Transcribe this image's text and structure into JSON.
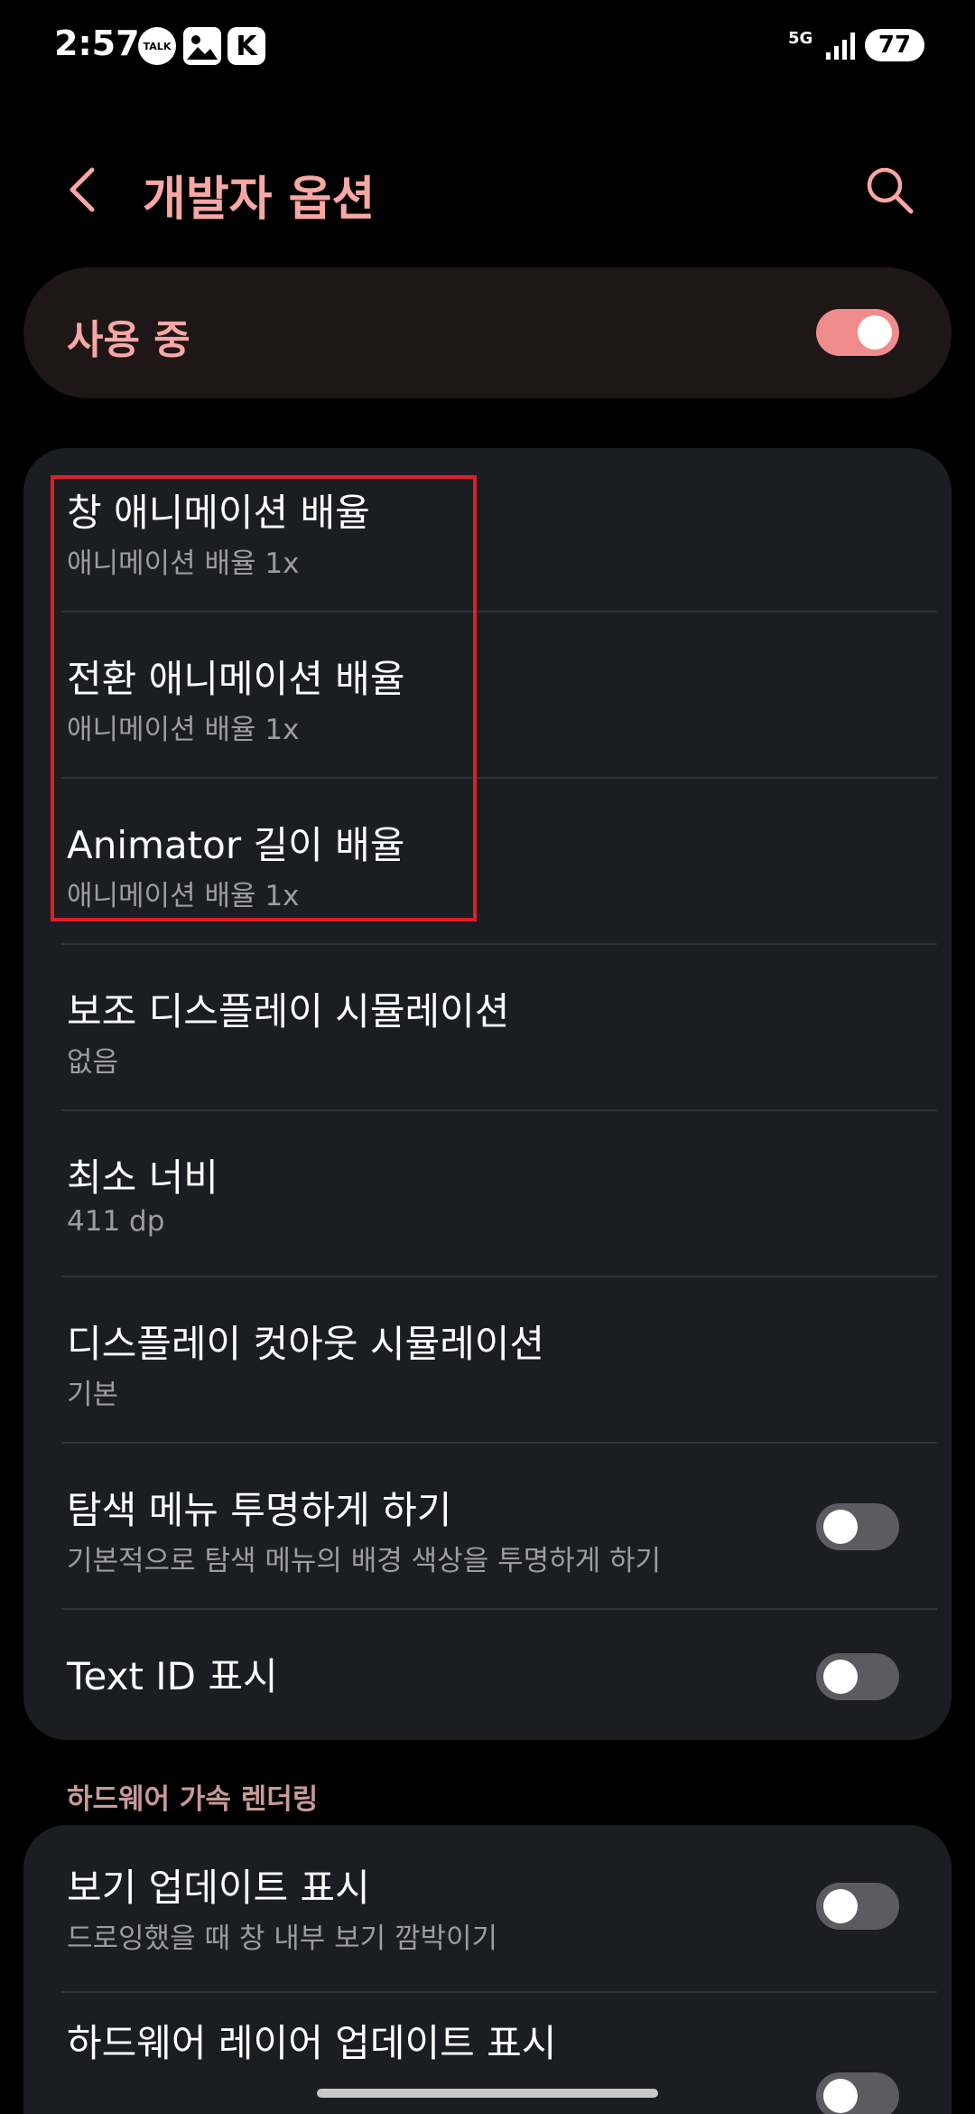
{
  "status_bar": {
    "time": "2:57",
    "talk_badge": "TALK",
    "k_badge": "K",
    "network": "5G",
    "battery": "77"
  },
  "header": {
    "title": "개발자 옵션",
    "accent_color": "#f7a7a4"
  },
  "master_switch": {
    "label": "사용 중",
    "on": true
  },
  "settings": [
    {
      "title": "창 애니메이션 배율",
      "subtitle": "애니메이션 배율 1x"
    },
    {
      "title": "전환 애니메이션 배율",
      "subtitle": "애니메이션 배율 1x"
    },
    {
      "title": "Animator 길이 배율",
      "subtitle": "애니메이션 배율 1x"
    },
    {
      "title": "보조 디스플레이 시뮬레이션",
      "subtitle": "없음"
    },
    {
      "title": "최소 너비",
      "subtitle": "411 dp"
    },
    {
      "title": "디스플레이 컷아웃 시뮬레이션",
      "subtitle": "기본"
    },
    {
      "title": "탐색 메뉴 투명하게 하기",
      "subtitle": "기본적으로 탐색 메뉴의 배경 색상을 투명하게 하기",
      "toggle": false
    },
    {
      "title": "Text ID 표시",
      "toggle": false
    }
  ],
  "hardware_section": {
    "header": "하드웨어 가속 렌더링",
    "items": [
      {
        "title": "보기 업데이트 표시",
        "subtitle": "드로잉했을 때 창 내부 보기 깜박이기",
        "toggle": false
      },
      {
        "title": "하드웨어 레이어 업데이트 표시",
        "toggle": false
      }
    ]
  }
}
